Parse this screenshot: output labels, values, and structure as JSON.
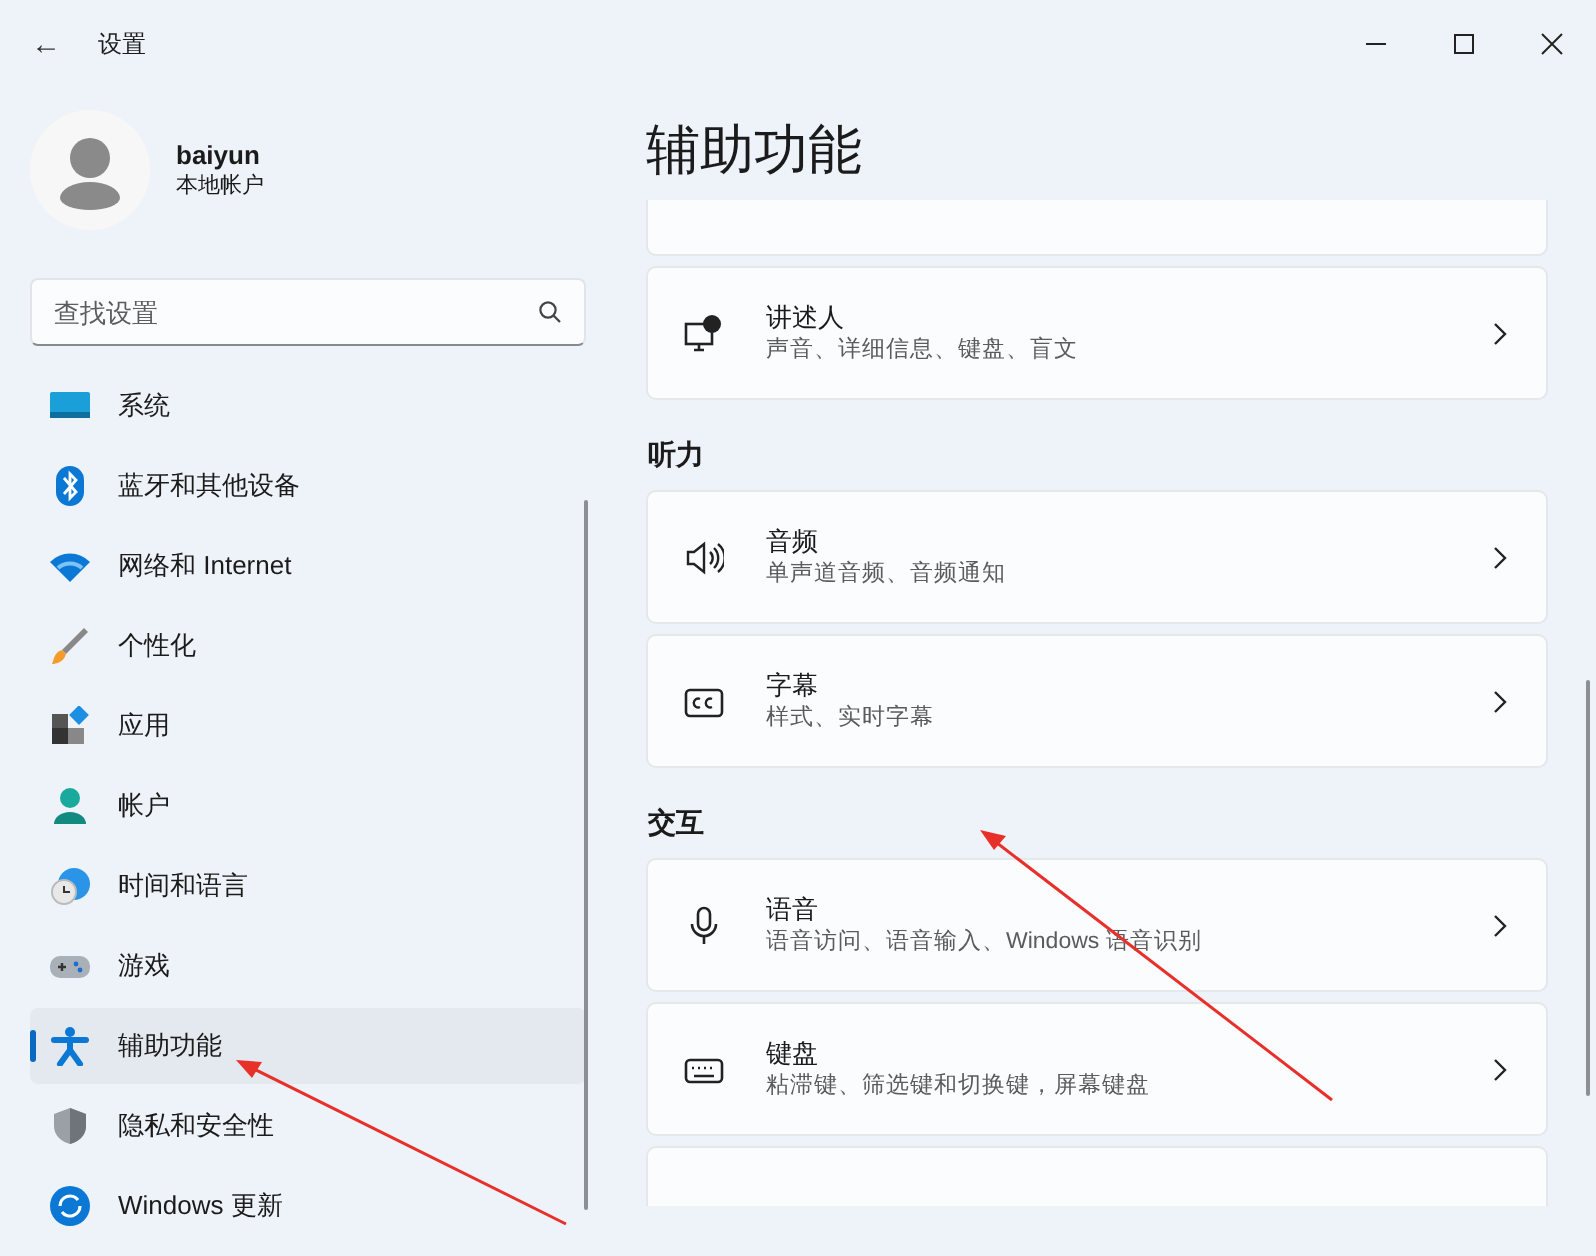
{
  "window": {
    "title": "设置",
    "back": "←"
  },
  "account": {
    "name": "baiyun",
    "type": "本地帐户"
  },
  "search": {
    "placeholder": "查找设置"
  },
  "nav": [
    {
      "label": "系统",
      "selected": false
    },
    {
      "label": "蓝牙和其他设备",
      "selected": false
    },
    {
      "label": "网络和 Internet",
      "selected": false
    },
    {
      "label": "个性化",
      "selected": false
    },
    {
      "label": "应用",
      "selected": false
    },
    {
      "label": "帐户",
      "selected": false
    },
    {
      "label": "时间和语言",
      "selected": false
    },
    {
      "label": "游戏",
      "selected": false
    },
    {
      "label": "辅助功能",
      "selected": true
    },
    {
      "label": "隐私和安全性",
      "selected": false
    },
    {
      "label": "Windows 更新",
      "selected": false
    }
  ],
  "page_title": "辅助功能",
  "sections": [
    {
      "cards": [
        {
          "kind": "narrator",
          "title": "讲述人",
          "subtitle": "声音、详细信息、键盘、盲文"
        }
      ]
    },
    {
      "heading": "听力",
      "cards": [
        {
          "kind": "audio",
          "title": "音频",
          "subtitle": "单声道音频、音频通知"
        },
        {
          "kind": "captions",
          "title": "字幕",
          "subtitle": "样式、实时字幕"
        }
      ]
    },
    {
      "heading": "交互",
      "cards": [
        {
          "kind": "speech",
          "title": "语音",
          "subtitle": "语音访问、语音输入、Windows 语音识别"
        },
        {
          "kind": "keyboard",
          "title": "键盘",
          "subtitle": "粘滞键、筛选键和切换键，屏幕键盘"
        }
      ]
    }
  ]
}
